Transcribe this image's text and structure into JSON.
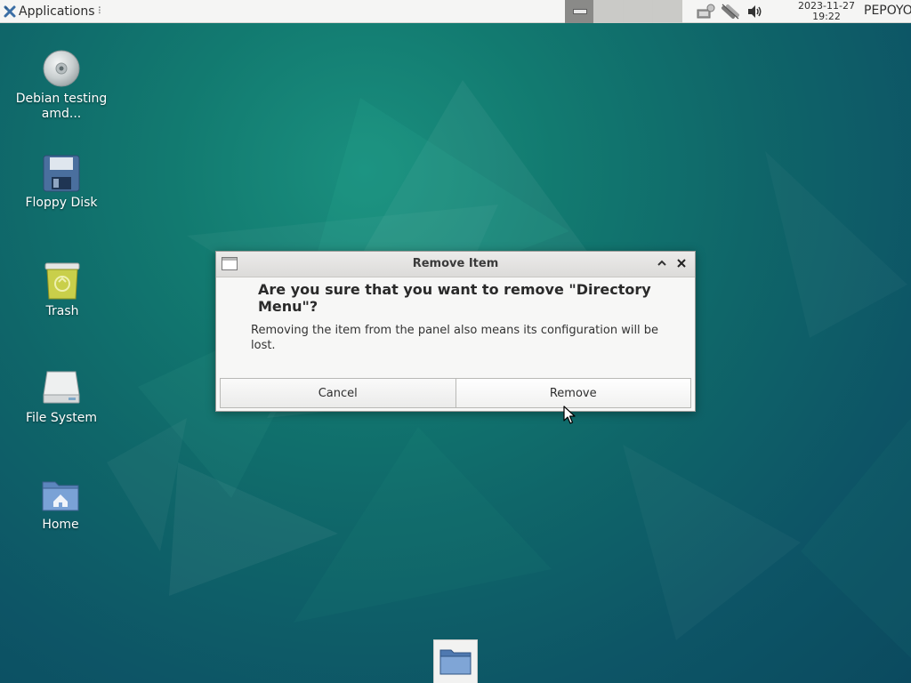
{
  "panel": {
    "applications_label": "Applications",
    "separator_glyph": "⠇",
    "workspaces": [
      {
        "name": "workspace-1",
        "active": true
      },
      {
        "name": "workspace-2",
        "active": false
      },
      {
        "name": "workspace-3",
        "active": false
      },
      {
        "name": "workspace-4",
        "active": false
      }
    ],
    "tray_icons": [
      "network-wired-icon",
      "network-disconnected-icon",
      "volume-icon"
    ],
    "clock_date": "2023-11-27",
    "clock_time": "19:22",
    "user": "PEPOYO"
  },
  "desktop_icons": [
    {
      "name": "debian-disc",
      "icon": "optical-disc-icon",
      "label": "Debian testing amd..."
    },
    {
      "name": "floppy-disk",
      "icon": "floppy-disk-icon",
      "label": "Floppy Disk"
    },
    {
      "name": "trash",
      "icon": "trash-icon",
      "label": "Trash"
    },
    {
      "name": "file-system",
      "icon": "drive-icon",
      "label": "File System"
    },
    {
      "name": "home",
      "icon": "home-folder-icon",
      "label": "Home"
    }
  ],
  "dialog": {
    "title": "Remove Item",
    "heading": "Are you sure that you want to remove \"Directory Menu\"?",
    "body": "Removing the item from the panel also means its configuration will be lost.",
    "cancel_label": "Cancel",
    "remove_label": "Remove"
  },
  "dock": {
    "items": [
      {
        "name": "file-manager",
        "icon": "folder-icon"
      }
    ]
  },
  "colors": {
    "panel_bg": "#f5f5f4",
    "wallpaper_dark": "#0b4a5f",
    "wallpaper_light": "#1a8f7e",
    "dialog_bg": "#f7f7f6"
  }
}
